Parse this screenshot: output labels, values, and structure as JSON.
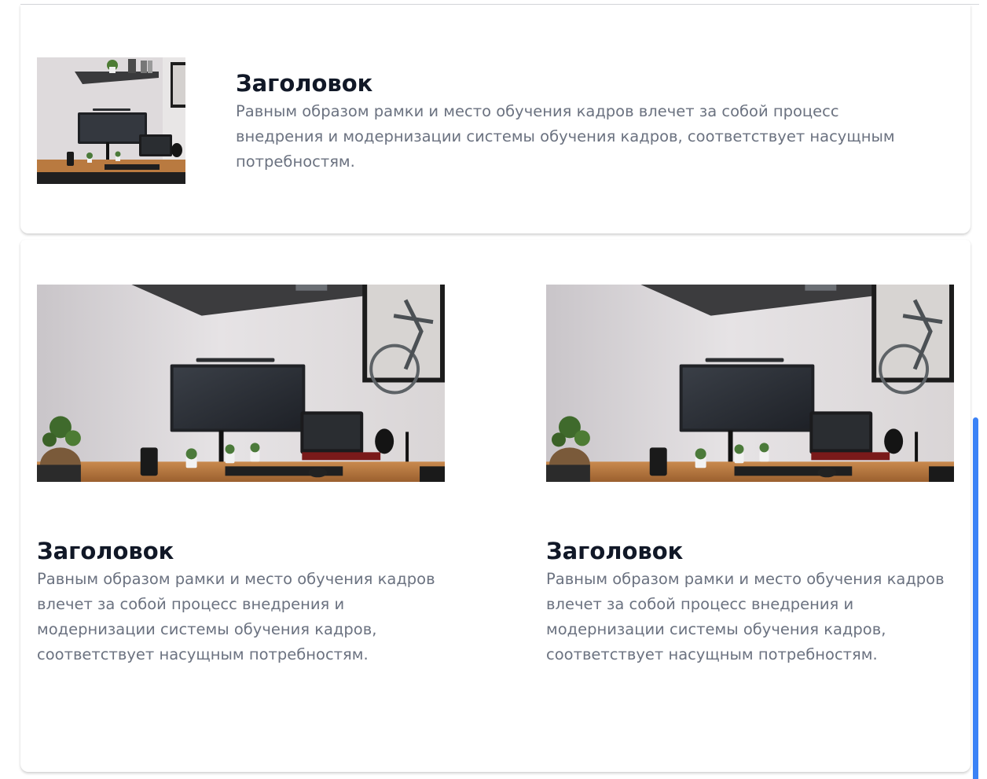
{
  "cards": {
    "featured": {
      "title": "Заголовок",
      "description": "Равным образом рамки и место обучения кадров влечет за собой процесс внедрения и модернизации системы обучения кадров, соответствует насущным потребностям."
    },
    "grid": [
      {
        "title": "Заголовок",
        "description": "Равным образом рамки и место обучения кадров влечет за собой процесс внедрения и модернизации системы обучения кадров, соответствует насущным потребностям."
      },
      {
        "title": "Заголовок",
        "description": "Равным образом рамки и место обучения кадров влечет за собой процесс внедрения и модернизации системы обучения кадров, соответствует насущным потребностям."
      }
    ]
  },
  "colors": {
    "title": "#111827",
    "description": "#6b7280",
    "scrollbar": "#3b82f6"
  }
}
